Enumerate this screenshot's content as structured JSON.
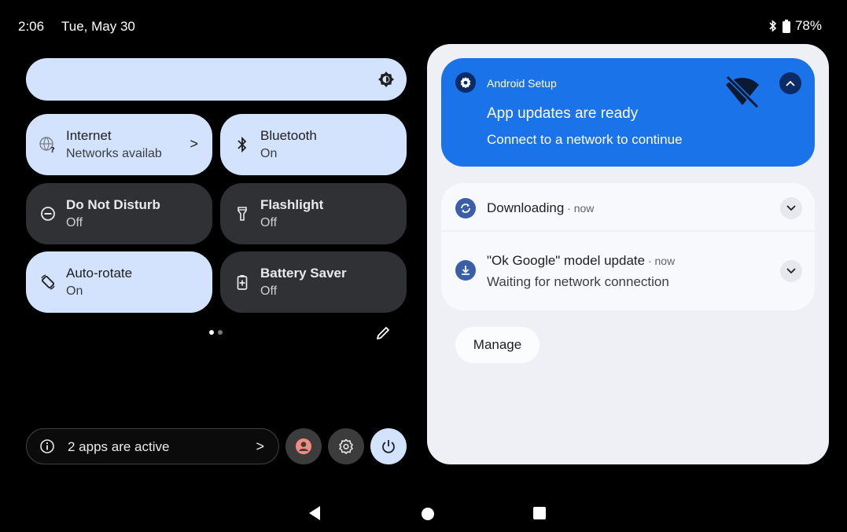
{
  "status_bar": {
    "time": "2:06",
    "date": "Tue, May 30",
    "battery": "78%",
    "icons": [
      "bluetooth-icon",
      "battery-icon"
    ]
  },
  "quick_settings": {
    "brightness_icon": "brightness-icon",
    "tiles": [
      {
        "title": "Internet",
        "subtitle": "Networks availab",
        "state": "on",
        "icon": "wifi-unknown-icon"
      },
      {
        "title": "Bluetooth",
        "subtitle": "On",
        "state": "on",
        "icon": "bluetooth-icon"
      },
      {
        "title": "Do Not Disturb",
        "subtitle": "Off",
        "state": "off",
        "icon": "do-not-disturb-icon"
      },
      {
        "title": "Flashlight",
        "subtitle": "Off",
        "state": "off",
        "icon": "flashlight-icon"
      },
      {
        "title": "Auto-rotate",
        "subtitle": "On",
        "state": "on",
        "icon": "auto-rotate-icon"
      },
      {
        "title": "Battery Saver",
        "subtitle": "Off",
        "state": "off",
        "icon": "battery-saver-icon"
      }
    ],
    "chevron": ">",
    "footer": {
      "active_apps_label": "2 apps are active",
      "chevron": ">"
    }
  },
  "notifications": {
    "setup": {
      "app_name": "Android Setup",
      "title": "App updates are ready",
      "text": "Connect to a network to continue"
    },
    "downloading": {
      "title": "Downloading",
      "when": " · now"
    },
    "ok_google": {
      "title": "\"Ok Google\" model update",
      "when": " · now",
      "text": "Waiting for network connection"
    },
    "manage_label": "Manage"
  },
  "colors": {
    "tile_on": "#d3e3fd",
    "tile_off": "#303134",
    "accent_blue": "#1a73e8",
    "shade_bg": "#eef0f5"
  }
}
